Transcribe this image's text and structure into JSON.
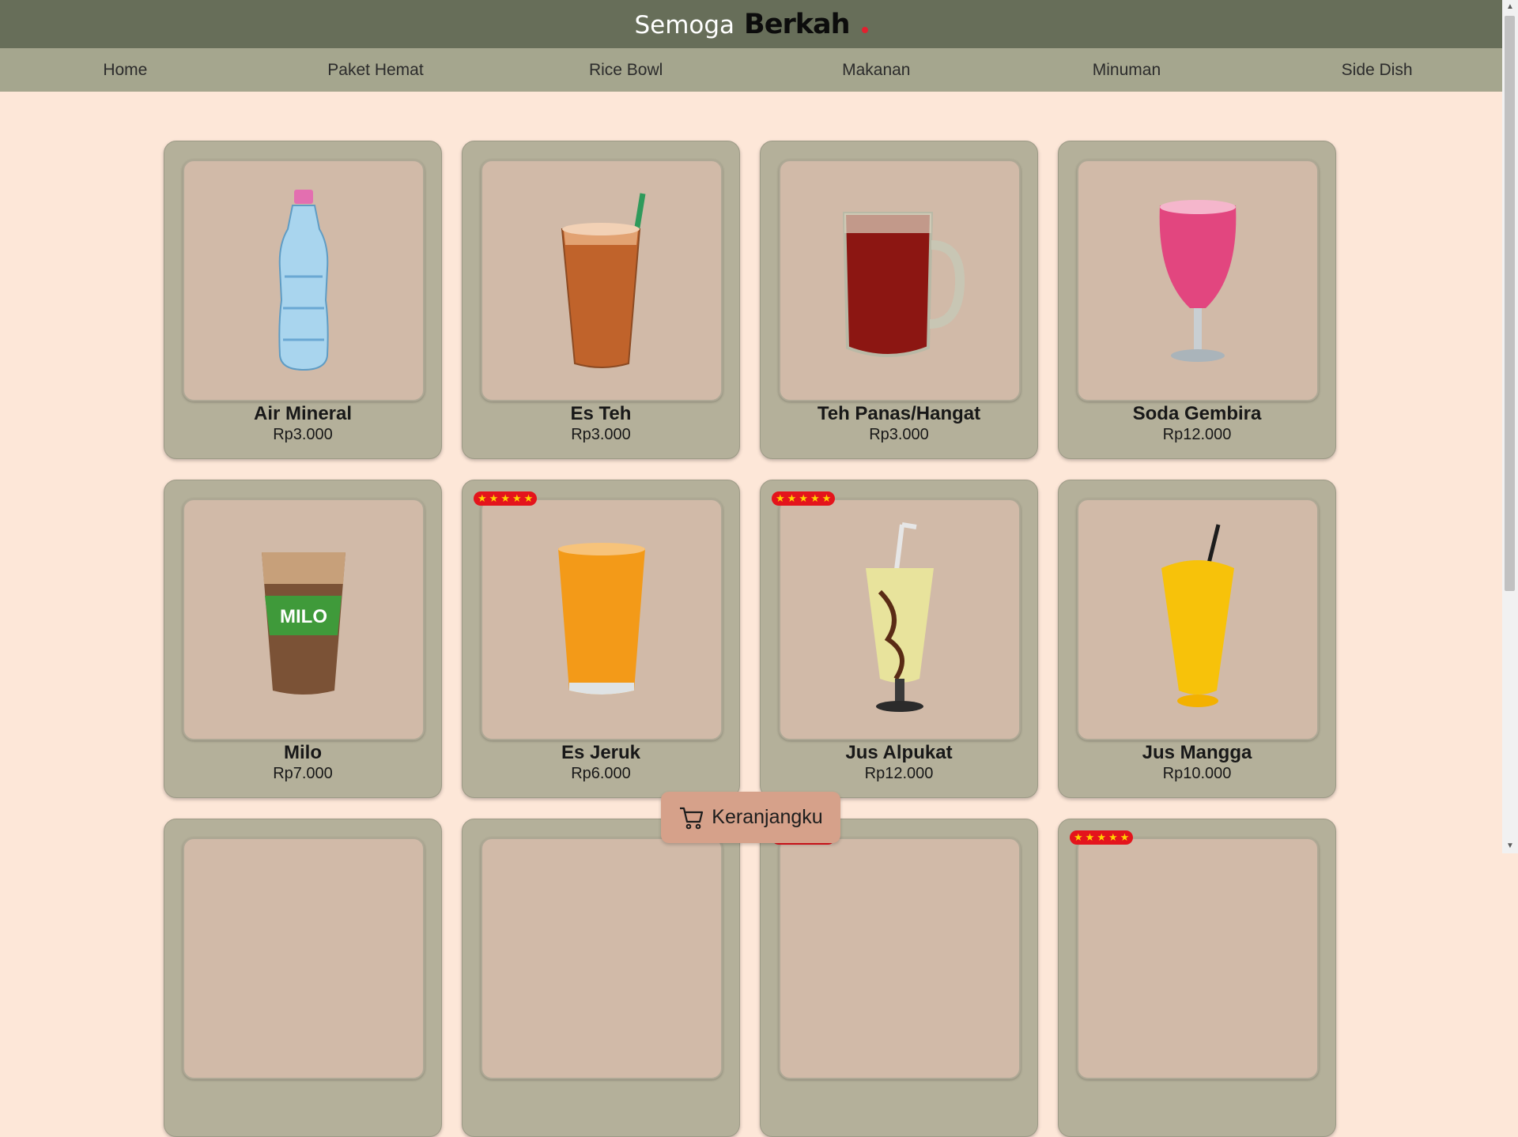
{
  "header": {
    "brand_first": "Semoga",
    "brand_second": "Berkah"
  },
  "nav": [
    "Home",
    "Paket Hemat",
    "Rice Bowl",
    "Makanan",
    "Minuman",
    "Side Dish"
  ],
  "products": [
    {
      "name": "Air Mineral",
      "price": "Rp3.000",
      "rating": null,
      "image_icon": "water-bottle-icon"
    },
    {
      "name": "Es Teh",
      "price": "Rp3.000",
      "rating": null,
      "image_icon": "iced-tea-icon"
    },
    {
      "name": "Teh Panas/Hangat",
      "price": "Rp3.000",
      "rating": null,
      "image_icon": "hot-tea-mug-icon"
    },
    {
      "name": "Soda Gembira",
      "price": "Rp12.000",
      "rating": null,
      "image_icon": "pink-soda-glass-icon"
    },
    {
      "name": "Milo",
      "price": "Rp7.000",
      "rating": null,
      "image_icon": "milo-cup-icon"
    },
    {
      "name": "Es Jeruk",
      "price": "Rp6.000",
      "rating": 5,
      "image_icon": "orange-juice-icon"
    },
    {
      "name": "Jus Alpukat",
      "price": "Rp12.000",
      "rating": 5,
      "image_icon": "avocado-juice-icon"
    },
    {
      "name": "Jus Mangga",
      "price": "Rp10.000",
      "rating": null,
      "image_icon": "mango-juice-icon"
    },
    {
      "name": "",
      "price": "",
      "rating": null,
      "image_icon": ""
    },
    {
      "name": "",
      "price": "",
      "rating": null,
      "image_icon": ""
    },
    {
      "name": "",
      "price": "",
      "rating": 5,
      "image_icon": ""
    },
    {
      "name": "",
      "price": "",
      "rating": 5,
      "image_icon": ""
    }
  ],
  "cart": {
    "label": "Keranjangku",
    "icon": "cart-icon"
  },
  "colors": {
    "header_bg": "#676e59",
    "nav_bg": "#a5a68e",
    "page_bg": "#fde7d8",
    "card_bg": "#b4b09a",
    "image_bg": "#d1baa8",
    "cart_bg": "#d6a18a",
    "star_badge": "#e4141c"
  }
}
